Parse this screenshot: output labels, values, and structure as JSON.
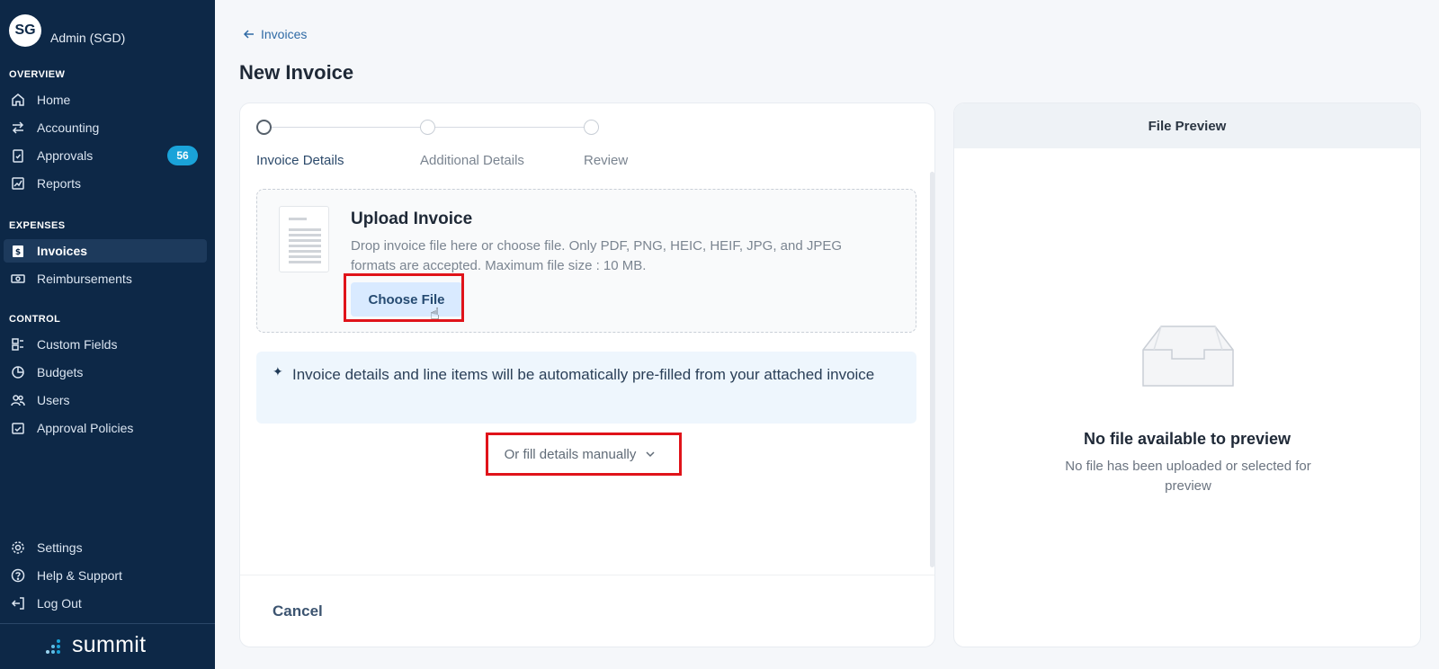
{
  "sidebar": {
    "avatar_initials": "SG",
    "profile_name": "Admin (SGD)",
    "sections": {
      "overview": "OVERVIEW",
      "expenses": "EXPENSES",
      "control": "CONTROL"
    },
    "items": {
      "home": "Home",
      "accounting": "Accounting",
      "approvals": "Approvals",
      "approvals_badge": "56",
      "reports": "Reports",
      "invoices": "Invoices",
      "reimbursements": "Reimbursements",
      "custom_fields": "Custom Fields",
      "budgets": "Budgets",
      "users": "Users",
      "approval_policies": "Approval Policies",
      "settings": "Settings",
      "help": "Help & Support",
      "logout": "Log Out"
    },
    "brand": "summit",
    "active_item": "invoices"
  },
  "header": {
    "back_label": "Invoices",
    "title": "New Invoice"
  },
  "stepper": {
    "steps": [
      "Invoice Details",
      "Additional Details",
      "Review"
    ],
    "current_index": 0
  },
  "upload": {
    "title": "Upload Invoice",
    "description": "Drop invoice file here or choose file. Only PDF, PNG, HEIC, HEIF, JPG, and JPEG formats are accepted. Maximum file size : 10 MB.",
    "button_label": "Choose File"
  },
  "info": {
    "text": "Invoice details and line items will be automatically pre-filled from your attached invoice"
  },
  "manual_toggle": {
    "label": "Or fill details manually"
  },
  "footer": {
    "cancel_label": "Cancel"
  },
  "preview": {
    "header": "File Preview",
    "empty_title": "No file available to preview",
    "empty_description": "No file has been uploaded or selected for preview"
  },
  "colors": {
    "sidebar_bg": "#0d2847",
    "accent": "#1aa3d9",
    "highlight": "#e0131a",
    "button_bg": "#d9eaff"
  },
  "icons": {
    "back": "arrow-left-icon",
    "home": "home-icon",
    "accounting": "swap-arrows-icon",
    "approvals": "clipboard-check-icon",
    "reports": "chart-line-icon",
    "invoices": "invoice-dollar-icon",
    "reimbursements": "banknote-icon",
    "custom_fields": "form-fields-icon",
    "budgets": "pie-chart-icon",
    "users": "users-icon",
    "approval_policies": "policy-check-icon",
    "settings": "gear-icon",
    "help": "question-circle-icon",
    "logout": "logout-icon",
    "sparkle": "sparkle-icon",
    "chevron": "chevron-down-icon",
    "empty_tray": "inbox-tray-icon"
  }
}
